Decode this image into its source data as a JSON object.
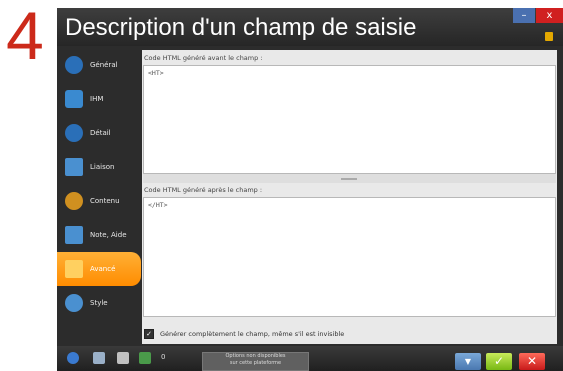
{
  "step_number": "4",
  "window": {
    "title": "Description d'un champ de saisie",
    "minimize_glyph": "–",
    "close_glyph": "x"
  },
  "sidebar": {
    "items": [
      {
        "label": "Général",
        "icon": "gear-circle-icon",
        "color": "#2a6fb8"
      },
      {
        "label": "IHM",
        "icon": "interface-icon",
        "color": "#3a8ad0"
      },
      {
        "label": "Détail",
        "icon": "detail-circle-icon",
        "color": "#2a6fb8"
      },
      {
        "label": "Liaison",
        "icon": "link-window-icon",
        "color": "#4a90d0"
      },
      {
        "label": "Contenu",
        "icon": "content-icon",
        "color": "#d09020"
      },
      {
        "label": "Note, Aide",
        "icon": "note-help-icon",
        "color": "#4a90d0"
      },
      {
        "label": "Avancé",
        "icon": "advanced-icon",
        "color": "#ffd060",
        "active": true
      },
      {
        "label": "Style",
        "icon": "style-icon",
        "color": "#4a90d0"
      }
    ]
  },
  "before": {
    "label": "Code HTML généré avant le champ :",
    "value": "<HT>"
  },
  "after": {
    "label": "Code HTML généré après le champ :",
    "value": "</HT>"
  },
  "option": {
    "label": "Générer complètement le champ, même s'il est invisible",
    "checked": true
  },
  "bottombar": {
    "counter": "0",
    "unavailable_line1": "Options non disponibles",
    "unavailable_line2": "sur cette plateforme",
    "more_glyph": "▼",
    "ok_glyph": "✓",
    "cancel_glyph": "✕"
  }
}
